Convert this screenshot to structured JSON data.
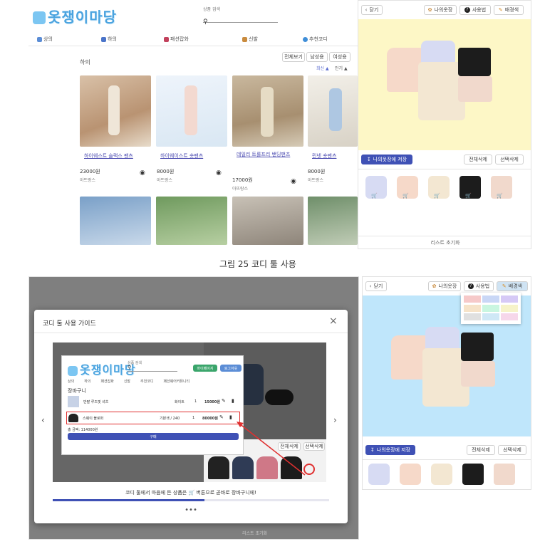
{
  "top": {
    "logo_text": "옷쟁이마당",
    "search_label": "상품 검색",
    "nav": [
      "상의",
      "하의",
      "패션잡화",
      "신발",
      "추천코디"
    ],
    "category_title": "하의",
    "filter_buttons": [
      "전체보기",
      "남성용",
      "여성용"
    ],
    "sort_options": [
      "최신 ▲",
      "인기 ▲"
    ],
    "products": [
      {
        "title": "하이웨스트 슬랙스 팬츠",
        "price": "23000원",
        "brand": "아뜨랑스"
      },
      {
        "title": "하이웨이스트 숏팬츠",
        "price": "8000원",
        "brand": "아뜨랑스"
      },
      {
        "title": "데일리 트롤프리 밴딩팬츠",
        "price": "17000원",
        "brand": "아뜨랑스"
      },
      {
        "title": "린넨 숏팬츠",
        "price": "8000원",
        "brand": "아뜨랑스"
      }
    ],
    "coord": {
      "close": "닫기",
      "my_closet": "나의옷장",
      "howto": "사용법",
      "bg_color": "배경색",
      "save": "나의옷장에 저장",
      "delete_all": "전체삭제",
      "delete_selected": "선택삭제",
      "list_reset": "리스트 초기화"
    }
  },
  "caption": "그림 25 코디 툴 사용",
  "bottom": {
    "modal_title": "코디 툴 사용 가이드",
    "modal_close": "×",
    "guide_text": "코디 툴에서 마음에 든 상품은 🛒 버튼으로 곧바로 장바구니에!",
    "carousel_dots": "•••",
    "inner": {
      "logo_text": "옷쟁이마당",
      "search_label": "상품 검색",
      "my_page": "마이페이지",
      "logout": "로그아웃",
      "nav": [
        "상의",
        "하의",
        "패션잡화",
        "신발",
        "추천코디",
        "패션웨어커뮤니티"
      ],
      "cart_title": "장바구니",
      "cart_rows": [
        {
          "name": "반팔 루즈핏 셔츠",
          "opt": "화이트",
          "qty": "1",
          "price": "15000원"
        },
        {
          "name": "스웨이 블로퍼",
          "opt": "기본색 / 240",
          "qty": "1",
          "price": "80000원"
        }
      ],
      "total": "총 금액: 114000원",
      "order": "구매"
    },
    "coord": {
      "close": "닫기",
      "my_closet": "나의옷장",
      "howto": "사용법",
      "bg_color": "배경색",
      "save": "나의옷장에 저장",
      "delete_all": "전체삭제",
      "delete_selected": "선택삭제",
      "list_reset": "리스트 초기화"
    },
    "palette": [
      "#f6c9c9",
      "#c9d7f6",
      "#d6c9f6",
      "#f6e3c9",
      "#c9f6e0",
      "#f6f3c9",
      "#e0e0e0",
      "#cfe8f6",
      "#f6d7ea"
    ]
  },
  "colors": {
    "accent": "#3f51b5",
    "yellow_bg": "#fdf7c6",
    "blue_bg": "#bfe6fb"
  }
}
